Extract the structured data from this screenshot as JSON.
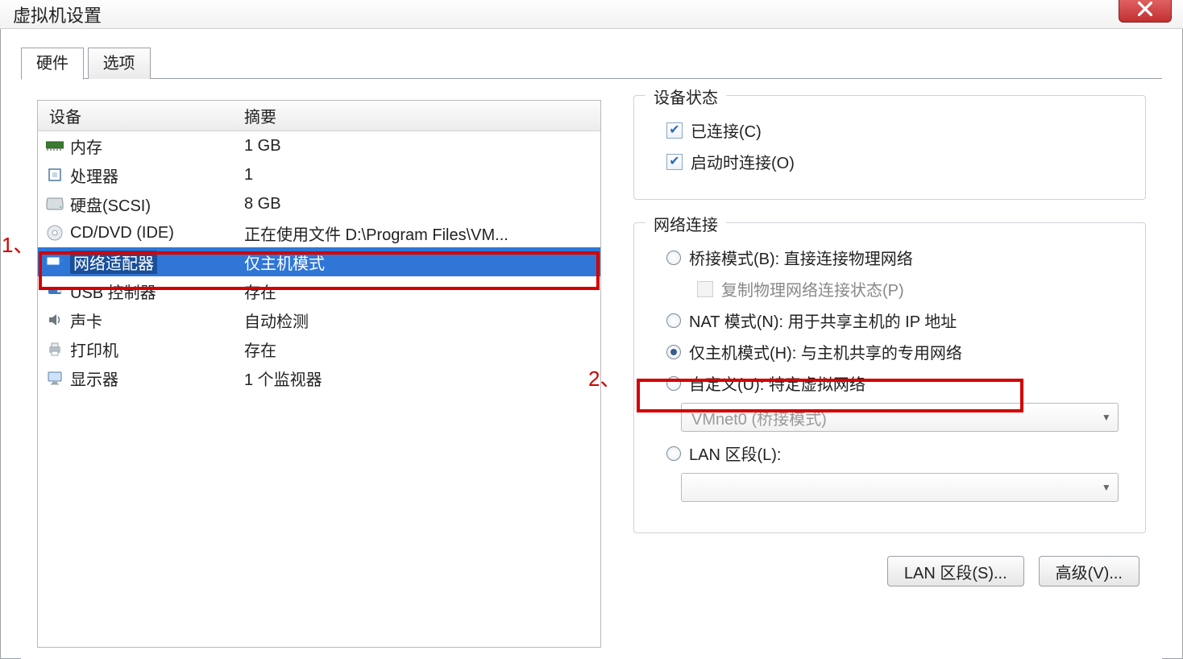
{
  "window": {
    "title": "虚拟机设置"
  },
  "tabs": {
    "hardware": "硬件",
    "options": "选项"
  },
  "device_headers": {
    "device": "设备",
    "summary": "摘要"
  },
  "devices": [
    {
      "name": "内存",
      "summary": "1 GB"
    },
    {
      "name": "处理器",
      "summary": "1"
    },
    {
      "name": "硬盘(SCSI)",
      "summary": "8 GB"
    },
    {
      "name": "CD/DVD (IDE)",
      "summary": "正在使用文件 D:\\Program Files\\VM..."
    },
    {
      "name": "网络适配器",
      "summary": "仅主机模式"
    },
    {
      "name": "USB 控制器",
      "summary": "存在"
    },
    {
      "name": "声卡",
      "summary": "自动检测"
    },
    {
      "name": "打印机",
      "summary": "存在"
    },
    {
      "name": "显示器",
      "summary": "1 个监视器"
    }
  ],
  "status_group": {
    "title": "设备状态",
    "connected": "已连接(C)",
    "connect_at_power_on": "启动时连接(O)"
  },
  "network_group": {
    "title": "网络连接",
    "bridged": "桥接模式(B): 直接连接物理网络",
    "replicate": "复制物理网络连接状态(P)",
    "nat": "NAT 模式(N): 用于共享主机的 IP 地址",
    "host_only": "仅主机模式(H): 与主机共享的专用网络",
    "custom": "自定义(U): 特定虚拟网络",
    "custom_combo": "VMnet0 (桥接模式)",
    "lan_segment": "LAN 区段(L):",
    "lan_combo": ""
  },
  "buttons": {
    "lan_segments": "LAN 区段(S)...",
    "advanced": "高级(V)..."
  },
  "annotations": {
    "one": "1、",
    "two": "2、"
  }
}
